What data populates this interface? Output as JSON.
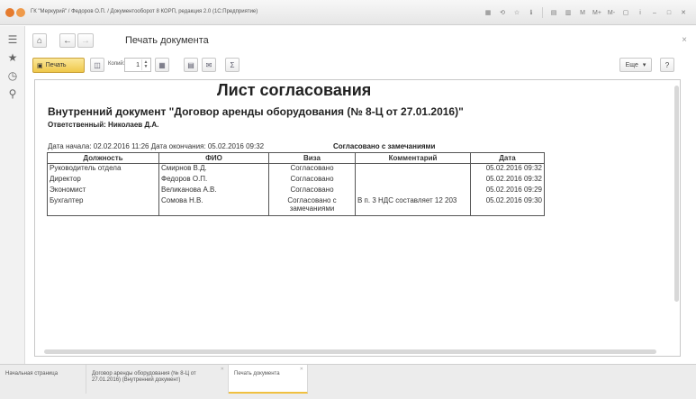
{
  "window": {
    "title": "ГК \"Меркурий\" / Федоров О.П. / Документооборот 8 КОРП, редакция 2.0 (1С:Предприятие)"
  },
  "titlebar_buttons": [
    "M",
    "M+",
    "M-"
  ],
  "header": {
    "title": "Печать документа",
    "close_label": "×"
  },
  "toolbar": {
    "print_label": "Печать",
    "copies_label": "Копий:",
    "copies_value": "1",
    "more_label": "Еще",
    "help_label": "?"
  },
  "document": {
    "title": "Лист согласования",
    "subtitle": "Внутренний документ \"Договор аренды оборудования (№ 8-Ц от 27.01.2016)\"",
    "responsible": "Ответственный: Николаев Д.А.",
    "dates": "Дата начала: 02.02.2016 11:26 Дата окончания: 05.02.2016 09:32",
    "status": "Согласовано с замечаниями",
    "columns": [
      "Должность",
      "ФИО",
      "Виза",
      "Комментарий",
      "Дата"
    ],
    "rows": [
      [
        "Руководитель отдела",
        "Смирнов В.Д.",
        "Согласовано",
        "",
        "05.02.2016 09:32"
      ],
      [
        "Директор",
        "Федоров О.П.",
        "Согласовано",
        "",
        "05.02.2016 09:32"
      ],
      [
        "Экономист",
        "Великанова А.В.",
        "Согласовано",
        "",
        "05.02.2016 09:29"
      ],
      [
        "Бухгалтер",
        "Сомова Н.В.",
        "Согласовано с замечаниями",
        "В п. 3 НДС составляет 12 203",
        "05.02.2016 09:30"
      ]
    ]
  },
  "bottom_tabs": [
    {
      "label": "Начальная страница"
    },
    {
      "label": "Договор аренды оборудования (№ 8-Ц от 27.01.2016) (Внутренний документ)"
    },
    {
      "label": "Печать документа"
    }
  ],
  "colors": {
    "accent": "#f0c040",
    "titlebar_circle_1": "#e57b2e",
    "titlebar_circle_2": "#ef9a4a"
  }
}
